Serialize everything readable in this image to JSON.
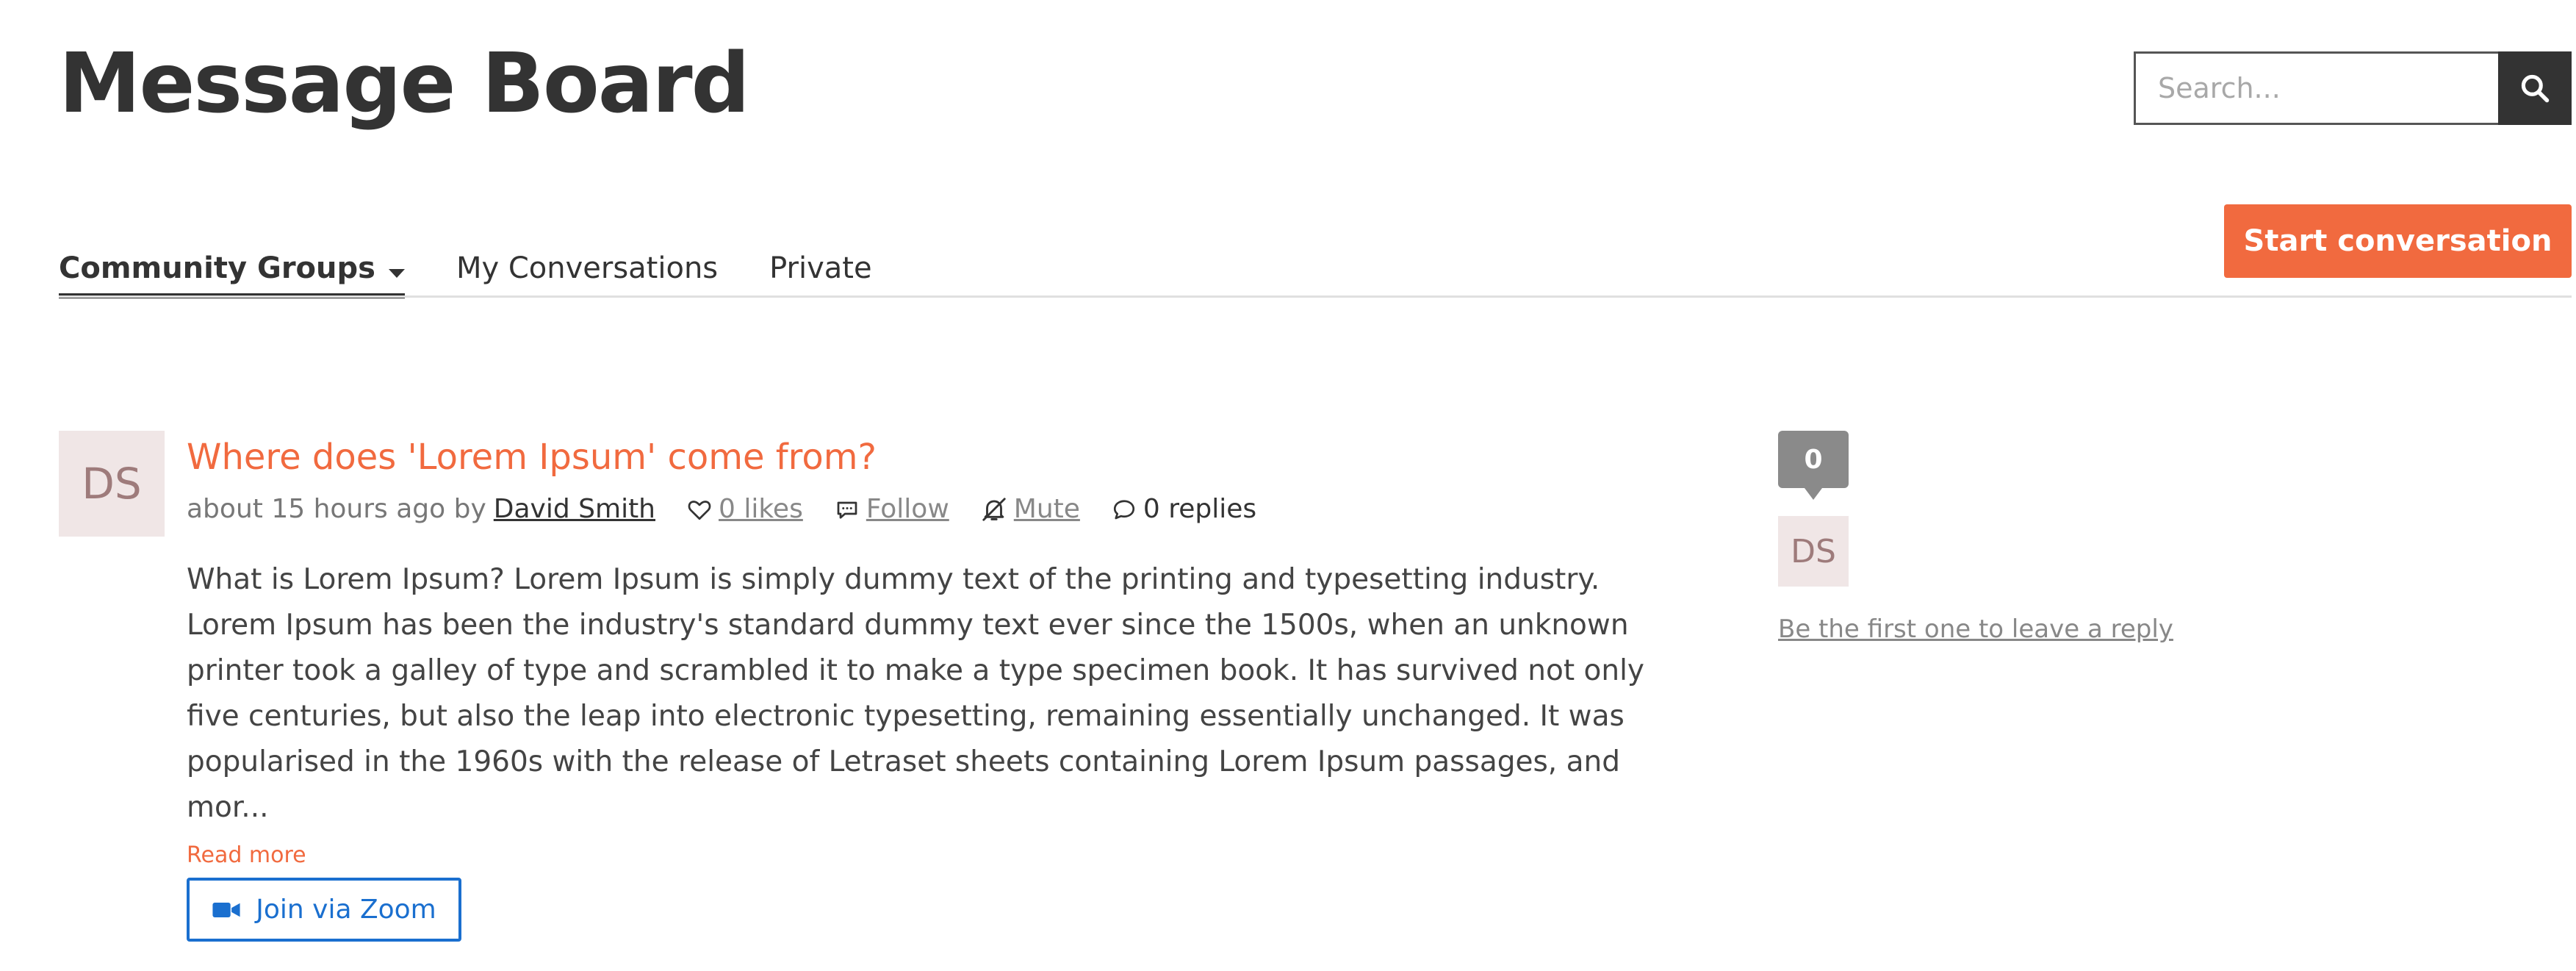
{
  "header": {
    "title": "Message Board",
    "search_placeholder": "Search...",
    "start_conversation_label": "Start conversation"
  },
  "tabs": [
    {
      "label": "Community Groups",
      "active": true,
      "has_dropdown": true
    },
    {
      "label": "My Conversations",
      "active": false
    },
    {
      "label": "Private",
      "active": false
    }
  ],
  "post": {
    "avatar_initials": "DS",
    "title": "Where does 'Lorem Ipsum' come from?",
    "time_text": "about 15 hours ago by",
    "author": "David Smith",
    "likes_label": "0 likes",
    "follow_label": "Follow",
    "mute_label": "Mute",
    "replies_label": "0 replies",
    "body_lines": [
      "What is Lorem Ipsum? Lorem Ipsum is simply dummy text of the printing and typesetting industry.",
      "Lorem Ipsum has been the industry's standard dummy text ever since the 1500s, when an unknown",
      "printer took a galley of type and scrambled it to make a type specimen book. It has survived not only",
      "five centuries, but also the leap into electronic typesetting, remaining essentially unchanged. It was",
      "popularised in the 1960s with the release of Letraset sheets containing Lorem Ipsum passages, and",
      "mor..."
    ],
    "read_more_label": "Read more",
    "zoom_label": "Join via Zoom"
  },
  "sidebar": {
    "reply_count": "0",
    "avatar_initials": "DS",
    "first_reply_label": "Be the first one to leave a reply"
  },
  "colors": {
    "accent": "#f16a3f",
    "zoom_blue": "#1a6fcf",
    "text_dark": "#333333",
    "badge_gray": "#8a8a8a",
    "avatar_bg": "#f0e6e6"
  },
  "icons": [
    "search-icon",
    "chevron-down-icon",
    "heart-icon",
    "comment-icon",
    "bell-off-icon",
    "reply-bubble-icon",
    "video-camera-icon"
  ]
}
